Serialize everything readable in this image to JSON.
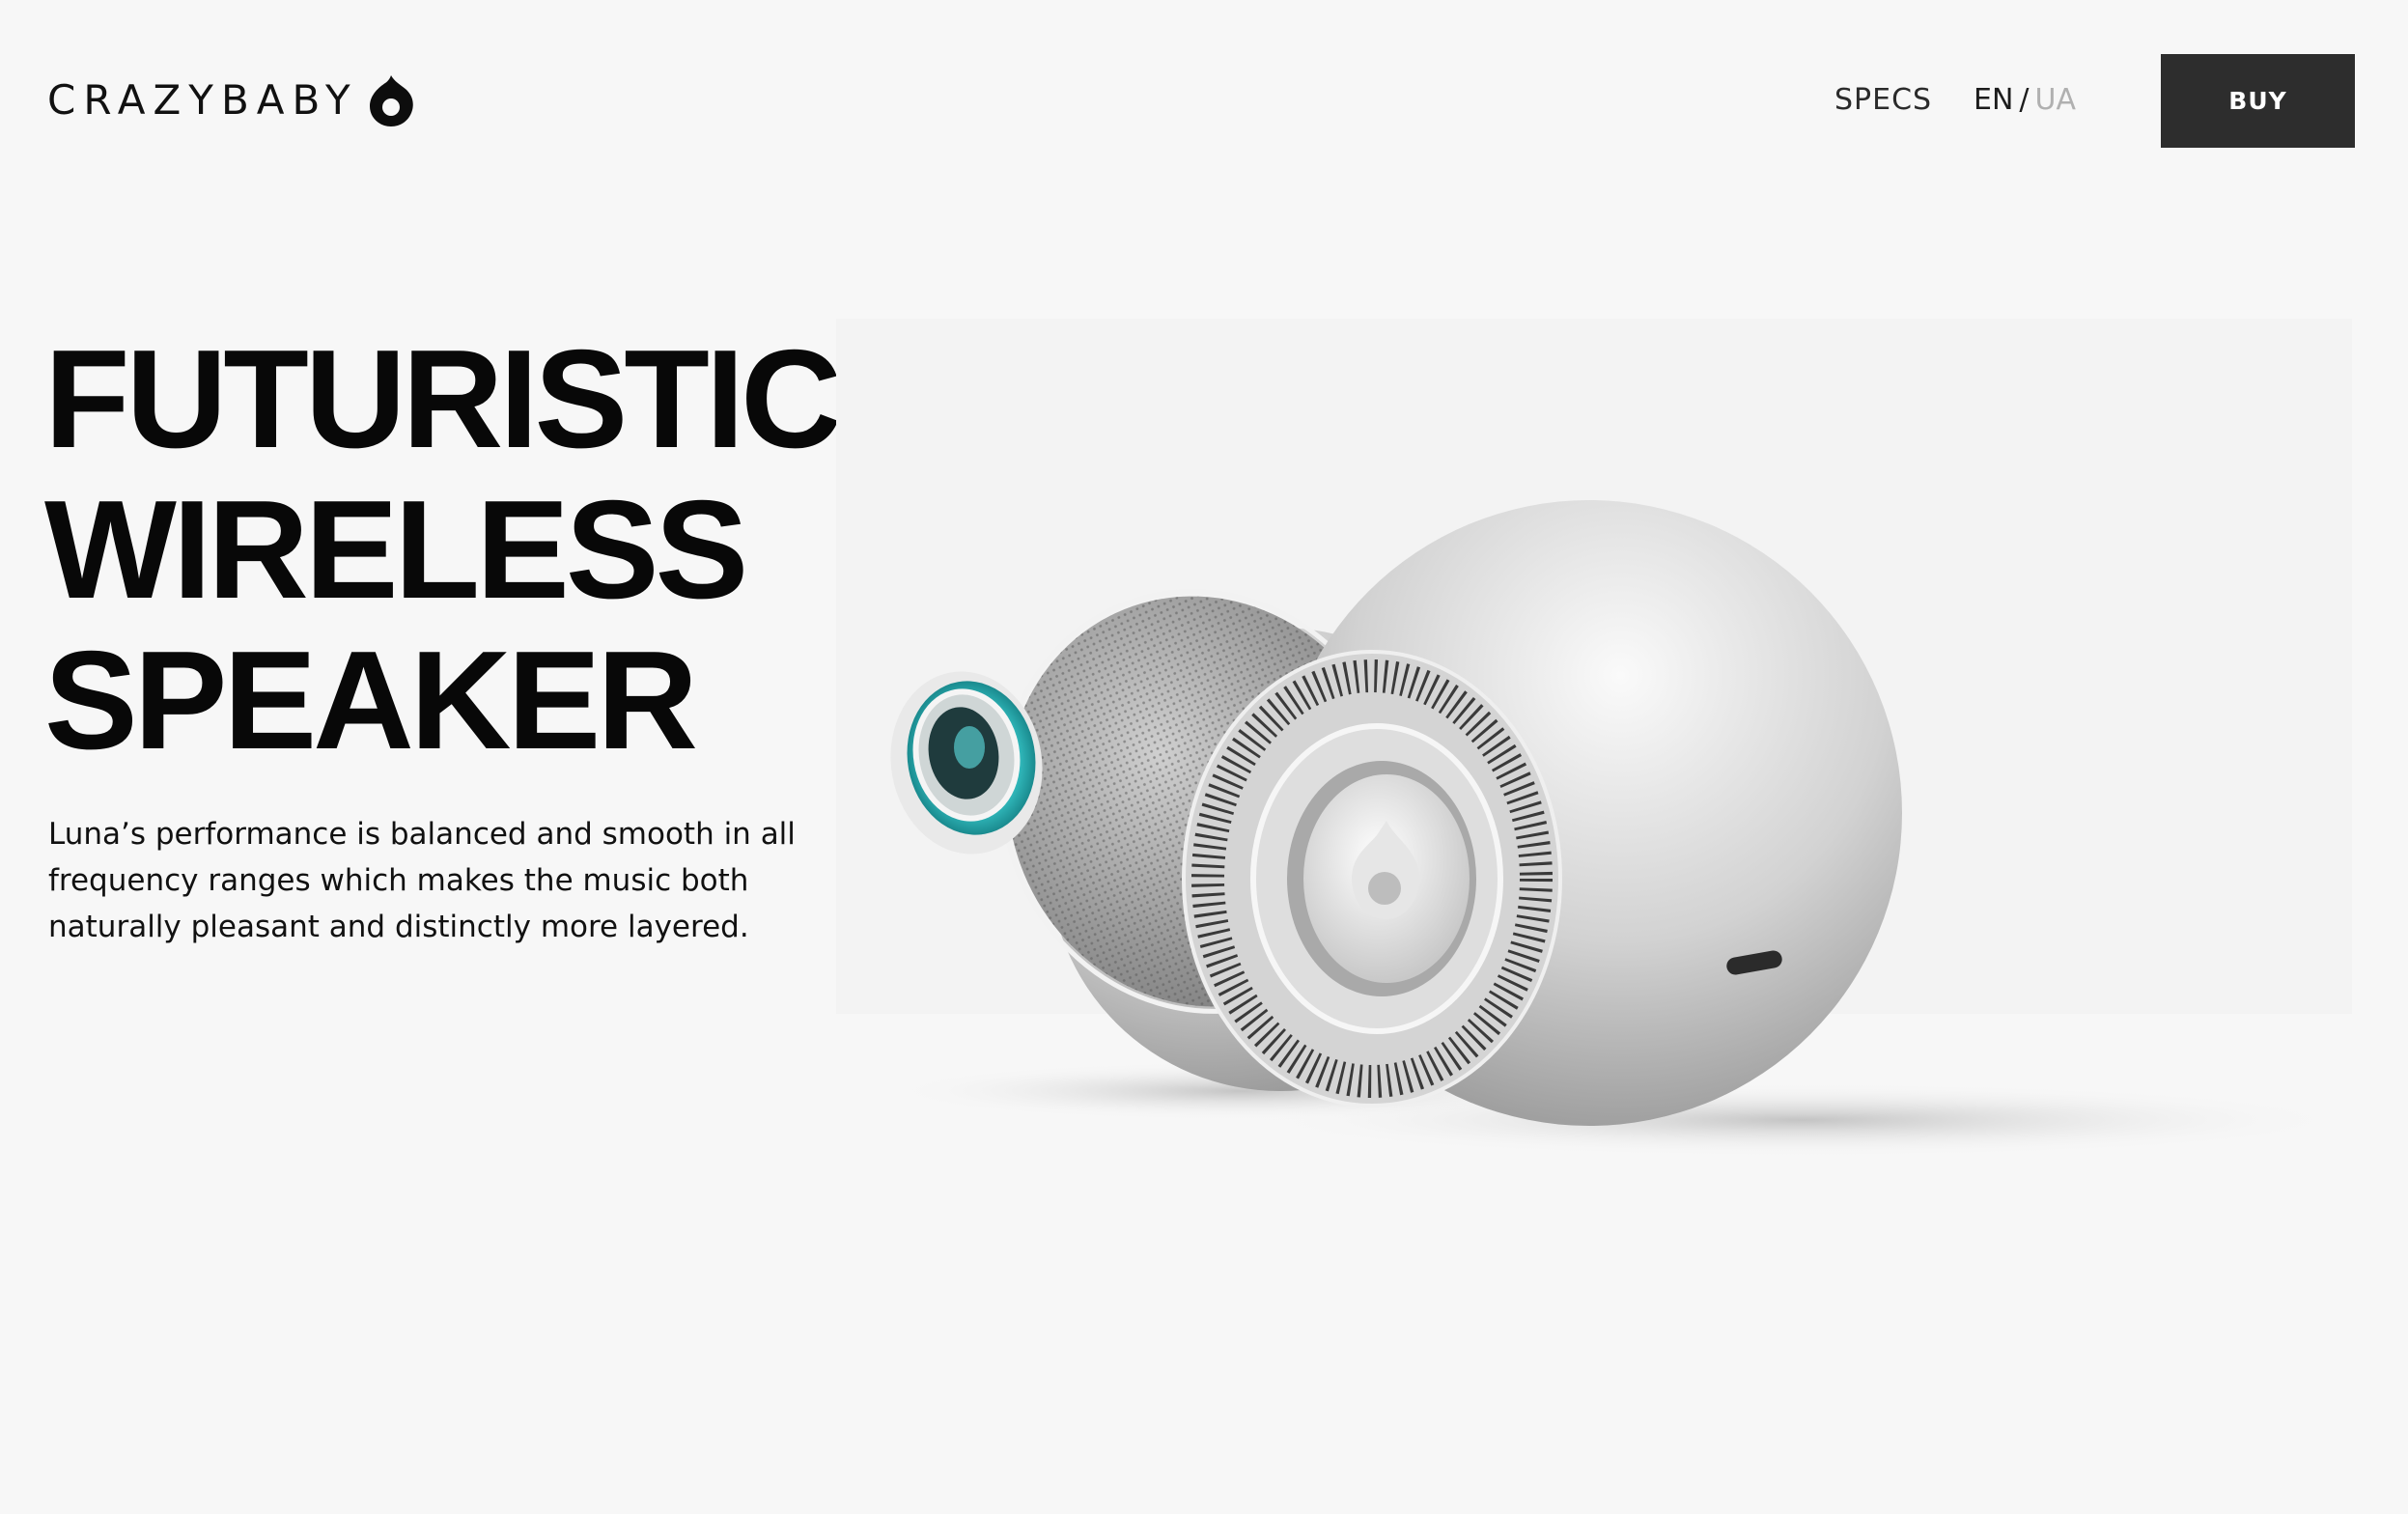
{
  "brand": {
    "name": "CRAZYBABY",
    "logo_icon": "drop-ring-icon"
  },
  "nav": {
    "specs_label": "SPECS",
    "lang_en": "EN",
    "lang_separator": "/",
    "lang_ua": "UA",
    "buy_label": "BUY"
  },
  "hero": {
    "headline_lines": [
      "FUTURISTIC",
      "WIRELESS",
      "SPEAKER"
    ],
    "description": "Luna’s performance is balanced and smooth in all frequency ranges which makes the music both naturally pleasant and distinctly more layered."
  },
  "colors": {
    "background": "#f7f7f7",
    "button": "#2d2d2d",
    "accent_glow": "#3fd6d8",
    "inactive_lang": "#b0b0b0"
  }
}
